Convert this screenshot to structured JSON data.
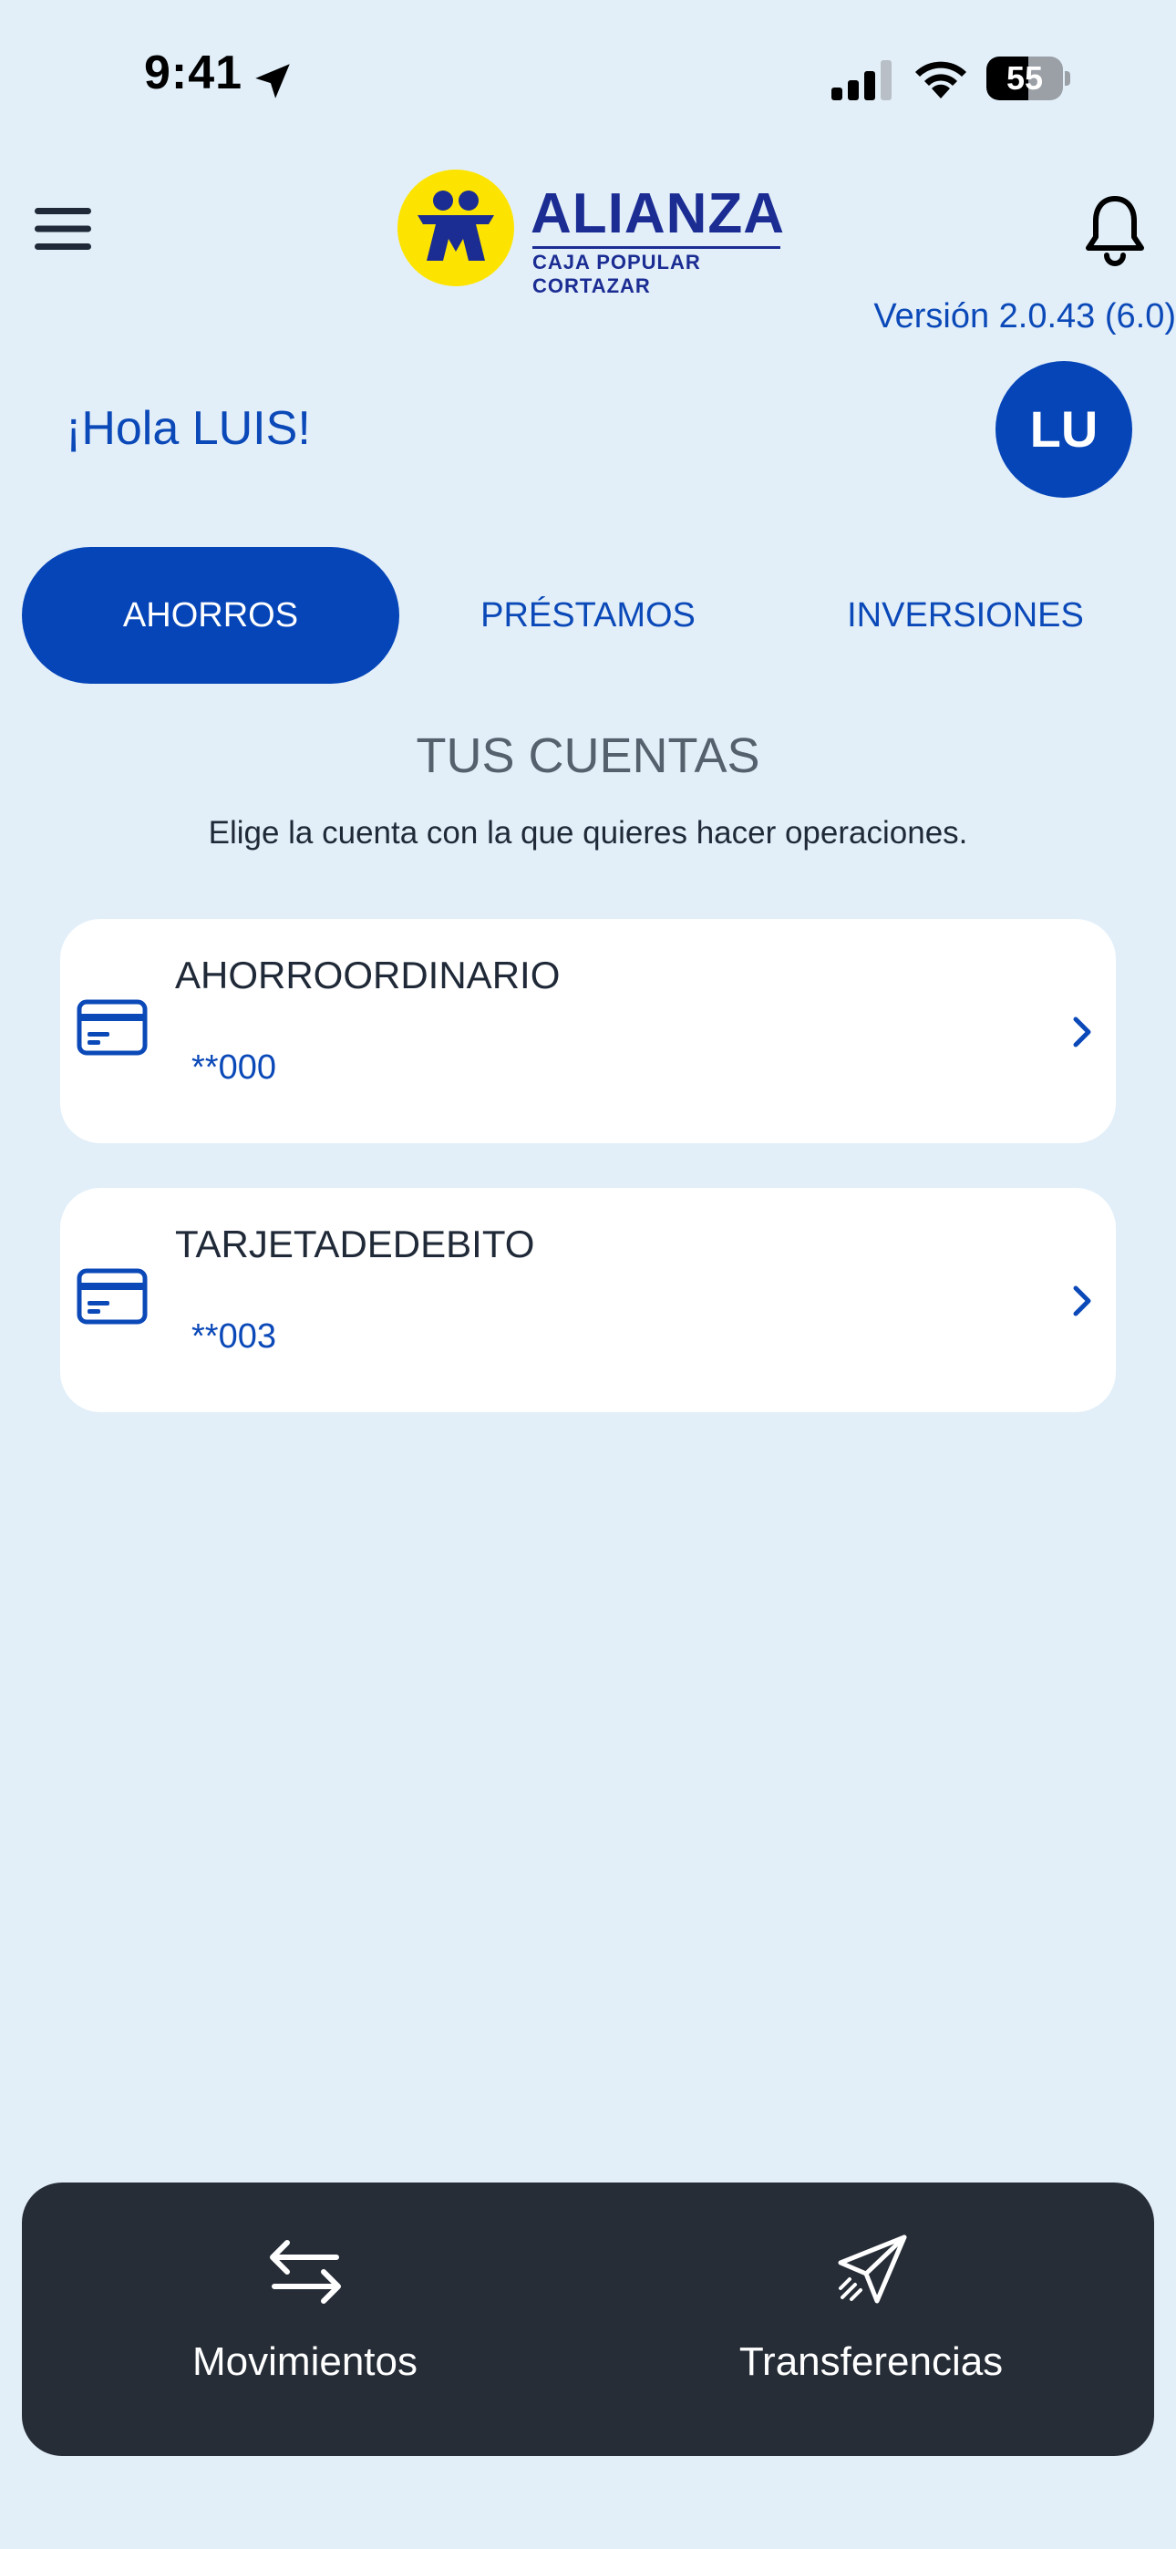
{
  "status_bar": {
    "time": "9:41",
    "battery": "55",
    "battery_level": 0.55,
    "icons": [
      "location-arrow-icon",
      "signal-icon",
      "wifi-icon",
      "battery-icon"
    ]
  },
  "header": {
    "logo_title": "ALIANZA",
    "logo_subtitle": "CAJA POPULAR CORTAZAR",
    "version": "Versión 2.0.43 (6.0)",
    "icons": [
      "menu-icon",
      "bell-icon"
    ]
  },
  "greeting": "¡Hola LUIS!",
  "avatar_initials": "LU",
  "tabs": [
    {
      "label": "AHORROS",
      "active": true
    },
    {
      "label": "PRÉSTAMOS",
      "active": false
    },
    {
      "label": "INVERSIONES",
      "active": false
    }
  ],
  "section": {
    "title": "TUS CUENTAS",
    "subtitle": "Elige la cuenta con la que quieres hacer operaciones."
  },
  "accounts": [
    {
      "name": "AHORROORDINARIO",
      "number": "**000"
    },
    {
      "name": "TARJETADEDEBITO",
      "number": "**003"
    }
  ],
  "bottom_nav": [
    {
      "label": "Movimientos",
      "icon": "arrows-exchange-icon"
    },
    {
      "label": "Transferencias",
      "icon": "paper-plane-icon"
    }
  ],
  "colors": {
    "background": "#e2eff9",
    "primary": "#0545b8",
    "text_primary": "#0b49b8",
    "bottom_bar": "#262d37",
    "logo_yellow": "#fde400",
    "logo_blue": "#1b2c93"
  }
}
